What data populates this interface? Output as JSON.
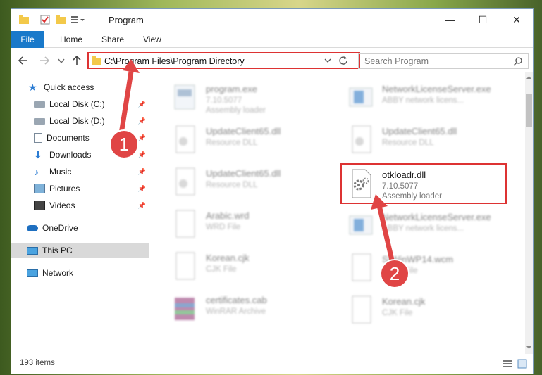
{
  "window": {
    "title": "Program",
    "minimize_glyph": "—",
    "maximize_glyph": "☐",
    "close_glyph": "✕"
  },
  "ribbon": {
    "file": "File",
    "home": "Home",
    "share": "Share",
    "view": "View"
  },
  "address": {
    "path": "C:\\Program Files\\Program Directory",
    "search_placeholder": "Search Program"
  },
  "sidebar": {
    "items": [
      {
        "label": "Quick access",
        "icon": "star-icon",
        "pinned": false
      },
      {
        "label": "Local Disk (C:)",
        "icon": "drive-icon",
        "pinned": true
      },
      {
        "label": "Local Disk (D:)",
        "icon": "drive-icon",
        "pinned": true
      },
      {
        "label": "Documents",
        "icon": "documents-icon",
        "pinned": true
      },
      {
        "label": "Downloads",
        "icon": "download-icon",
        "pinned": true
      },
      {
        "label": "Music",
        "icon": "music-icon",
        "pinned": true
      },
      {
        "label": "Pictures",
        "icon": "pictures-icon",
        "pinned": true
      },
      {
        "label": "Videos",
        "icon": "videos-icon",
        "pinned": true
      },
      {
        "label": "OneDrive",
        "icon": "cloud-icon",
        "pinned": false
      },
      {
        "label": "This PC",
        "icon": "computer-icon",
        "pinned": false,
        "selected": true
      },
      {
        "label": "Network",
        "icon": "network-icon",
        "pinned": false
      }
    ]
  },
  "files": [
    {
      "name": "program.exe",
      "line1": "7.10.5077",
      "line2": "Assembly loader",
      "icon": "exe-icon"
    },
    {
      "name": "NetworkLicenseServer.exe",
      "line1": "ABBY network licens...",
      "line2": "",
      "icon": "exe-icon"
    },
    {
      "name": "UpdateClient65.dll",
      "line1": "Resource DLL",
      "line2": "",
      "icon": "dll-icon"
    },
    {
      "name": "UpdateClient65.dll",
      "line1": "Resource DLL",
      "line2": "",
      "icon": "dll-icon"
    },
    {
      "name": "UpdateClient65.dll",
      "line1": "Resource DLL",
      "line2": "",
      "icon": "dll-icon"
    },
    {
      "name": "otkloadr.dll",
      "line1": "7.10.5077",
      "line2": "Assembly loader",
      "icon": "gear-dll-icon"
    },
    {
      "name": "Arabic.wrd",
      "line1": "WRD File",
      "line2": "",
      "icon": "file-icon"
    },
    {
      "name": "NetworkLicenseServer.exe",
      "line1": "ABBY network licens...",
      "line2": "",
      "icon": "exe-icon"
    },
    {
      "name": "Korean.cjk",
      "line1": "CJK File",
      "line2": "",
      "icon": "file-icon"
    },
    {
      "name": "SrWinWP14.wcm",
      "line1": "WCM File",
      "line2": "",
      "icon": "file-icon"
    },
    {
      "name": "certificates.cab",
      "line1": "WinRAR Archive",
      "line2": "",
      "icon": "rar-icon"
    },
    {
      "name": "Korean.cjk",
      "line1": "CJK File",
      "line2": "",
      "icon": "file-icon"
    }
  ],
  "status": {
    "count": "193 items"
  },
  "annotations": {
    "step1": "1",
    "step2": "2"
  },
  "colors": {
    "accent": "#1979ca",
    "highlight": "#dd3333"
  }
}
